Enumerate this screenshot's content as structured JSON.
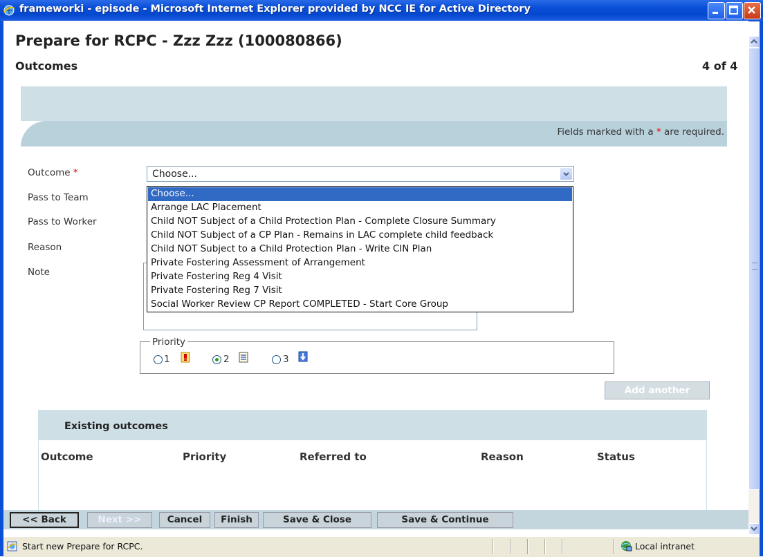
{
  "window": {
    "title": "frameworki - episode - Microsoft Internet Explorer provided by NCC IE for Active Directory"
  },
  "page": {
    "title": "Prepare for RCPC - Zzz Zzz (100080866)",
    "section": "Outcomes",
    "counter": "4 of 4"
  },
  "form": {
    "required_note_prefix": "Fields marked with a",
    "required_star": "*",
    "required_note_suffix": "are required.",
    "labels": {
      "outcome": "Outcome",
      "pass_to_team": "Pass to Team",
      "pass_to_worker": "Pass to Worker",
      "reason": "Reason",
      "note": "Note"
    },
    "outcome_select": {
      "value": "Choose...",
      "options": [
        "Choose...",
        "Arrange LAC Placement",
        "Child NOT Subject of a Child Protection Plan - Complete Closure Summary",
        "Child NOT Subject of a CP Plan - Remains in LAC complete child feedback",
        "Child NOT Subject to a Child Protection Plan - Write CIN Plan",
        "Private Fostering Assessment of Arrangement",
        "Private Fostering Reg 4 Visit",
        "Private Fostering Reg 7 Visit",
        "Social Worker Review CP Report COMPLETED - Start Core Group"
      ],
      "highlighted_index": 0
    },
    "priority": {
      "legend": "Priority",
      "options": [
        "1",
        "2",
        "3"
      ],
      "selected": "2"
    },
    "add_another": "Add another"
  },
  "existing_outcomes": {
    "title": "Existing outcomes",
    "columns": [
      "Outcome",
      "Priority",
      "Referred to",
      "Reason",
      "Status"
    ]
  },
  "buttons": {
    "back": "<< Back",
    "next": "Next >>",
    "cancel": "Cancel",
    "finish": "Finish",
    "save_close": "Save & Close",
    "save_continue": "Save & Continue"
  },
  "statusbar": {
    "text": "Start new Prepare for RCPC.",
    "zone": "Local intranet"
  },
  "colors": {
    "title_bar": "#0a4fd8",
    "panel_band": "#cfdfe6",
    "selection": "#316ac5",
    "required": "#e00000"
  }
}
